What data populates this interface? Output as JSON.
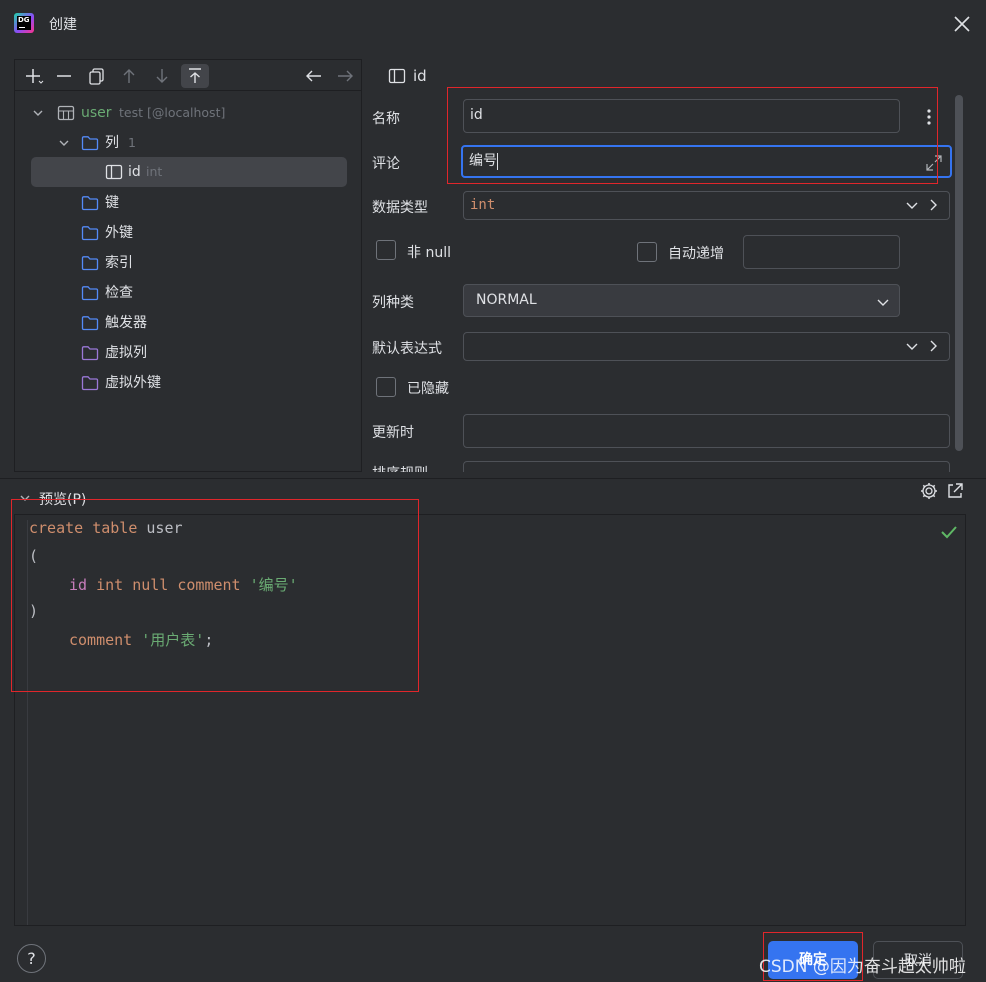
{
  "dialog": {
    "title": "创建",
    "app_logo_text": "DG"
  },
  "tree": {
    "root": {
      "label": "user",
      "meta": "test [@localhost]"
    },
    "columns_folder": {
      "label": "列",
      "count": "1"
    },
    "column_item": {
      "label": "id",
      "type": "int"
    },
    "folders": [
      "键",
      "外键",
      "索引",
      "检查",
      "触发器",
      "虚拟列",
      "虚拟外键"
    ]
  },
  "form": {
    "header": "id",
    "name_label": "名称",
    "name_value": "id",
    "comment_label": "评论",
    "comment_value": "编号",
    "datatype_label": "数据类型",
    "datatype_value": "int",
    "notnull_label": "非 null",
    "autoinc_label": "自动递增",
    "kind_label": "列种类",
    "kind_value": "NORMAL",
    "default_label": "默认表达式",
    "hidden_label": "已隐藏",
    "onupdate_label": "更新时",
    "collation_label": "排序规则"
  },
  "preview": {
    "label": "预览(P)",
    "code": {
      "l1_kw": "create table",
      "l1_name": " user",
      "l2": "(",
      "l3_ident": "id",
      "l3_kw": " int null comment ",
      "l3_str": "'编号'",
      "l4": ")",
      "l5_kw": "comment ",
      "l5_str": "'用户表'",
      "l5_end": ";"
    }
  },
  "buttons": {
    "help": "?",
    "ok": "确定",
    "cancel": "取消"
  },
  "watermark": "CSDN @因为奋斗超太帅啦",
  "colors": {
    "accent": "#3574f0",
    "highlight_red": "#e0262b",
    "folder_blue": "#548af7",
    "folder_purple": "#9a78d8"
  }
}
